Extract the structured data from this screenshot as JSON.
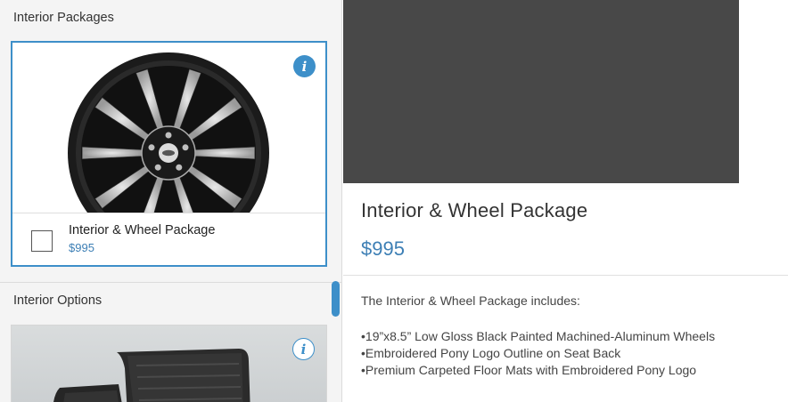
{
  "left_panel": {
    "interior_packages_title": "Interior Packages",
    "interior_options_title": "Interior Options",
    "package_card": {
      "name": "Interior & Wheel Package",
      "price": "$995",
      "info_icon": "info-icon",
      "selected": true,
      "checked": false
    },
    "mat_card": {
      "info_icon": "info-icon"
    }
  },
  "detail": {
    "name": "Interior & Wheel Package",
    "price": "$995",
    "intro": "The Interior & Wheel Package includes:",
    "features": [
      "•19”x8.5” Low Gloss Black Painted Machined-Aluminum Wheels",
      "•Embroidered Pony Logo Outline on Seat Back",
      "•Premium Carpeted Floor Mats with Embroidered Pony Logo"
    ]
  },
  "colors": {
    "accent": "#3d8fc9",
    "price": "#3d7fb5",
    "media_placeholder": "#484848"
  }
}
